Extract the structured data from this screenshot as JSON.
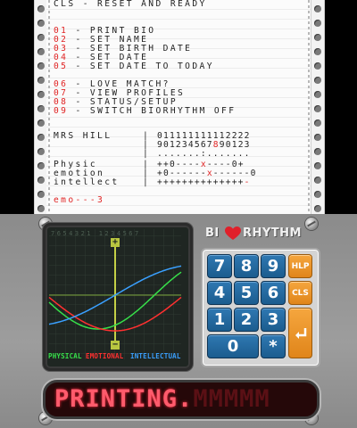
{
  "printout": {
    "header": "CLS - RESET AND READY",
    "menu": [
      {
        "num": "01",
        "label": " - PRINT BIO"
      },
      {
        "num": "02",
        "label": " - SET NAME"
      },
      {
        "num": "03",
        "label": " - SET BIRTH DATE"
      },
      {
        "num": "04",
        "label": " - SET DATE"
      },
      {
        "num": "05",
        "label": " - SET DATE TO TODAY"
      }
    ],
    "menu2": [
      {
        "num": "06",
        "label": " - LOVE MATCH?"
      },
      {
        "num": "07",
        "label": " - VIEW PROFILES"
      },
      {
        "num": "08",
        "label": " - STATUS/SETUP"
      },
      {
        "num": "09",
        "label": " - SWITCH BIORHYTHM OFF"
      }
    ],
    "profile_name": "MRS HILL",
    "day_row1": "011111111112222",
    "day_row2_a": "901234567",
    "day_row2_b": "8",
    "day_row2_c": "90123",
    "dots_row": ".......:.......",
    "rows": [
      {
        "label": "Physic",
        "a": "++0----",
        "b": "x",
        "c": "----0+"
      },
      {
        "label": "emotion",
        "a": "+0------",
        "b": "x",
        "c": "------0"
      },
      {
        "label": "intellect",
        "a": "++++++++++++++",
        "b": "",
        "c": "-"
      }
    ],
    "result_prefix": "emo",
    "result_suffix": "---3"
  },
  "scope": {
    "scale": "7654321 1234567",
    "plus": "+",
    "minus": "−",
    "legend": {
      "physical": "PHYSICAL",
      "emotional": "EMOTIONAL",
      "intellectual": "INTELLECTUAL"
    }
  },
  "logo": {
    "left": "BI",
    "right": "RHYTHM",
    "heart_color": "#e0202a"
  },
  "keypad": {
    "keys": [
      "7",
      "8",
      "9",
      "4",
      "5",
      "6",
      "1",
      "2",
      "3",
      "0",
      "*"
    ],
    "help": "HLP",
    "clear": "CLS",
    "enter_icon": "enter-icon"
  },
  "display": {
    "text": "PRINTING.",
    "tail": "MMMMM"
  },
  "colors": {
    "physical": "#37e04a",
    "emotional": "#ff3030",
    "intellectual": "#3aa0ff"
  }
}
